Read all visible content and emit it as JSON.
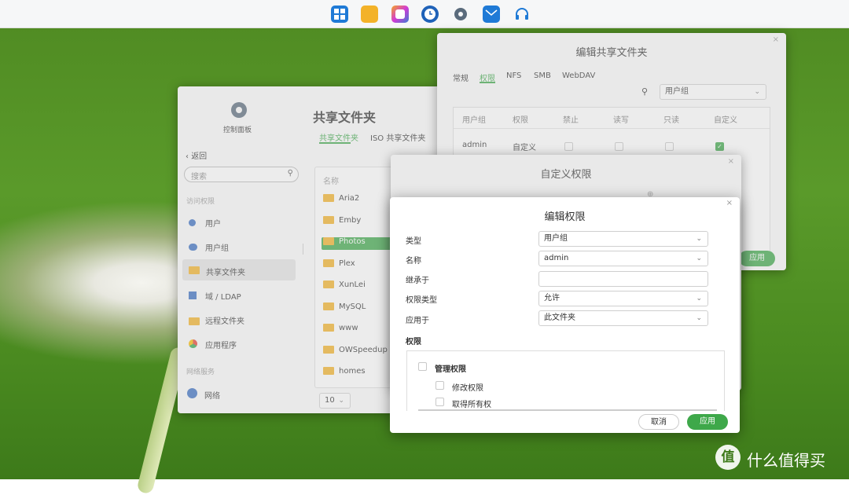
{
  "taskbar": {
    "icons": [
      {
        "name": "start-icon",
        "color": "#1f7ad6"
      },
      {
        "name": "folder-icon",
        "color": "#f3b229"
      },
      {
        "name": "app-center-icon",
        "color": "#c23bd4"
      },
      {
        "name": "clock-icon",
        "color": "#1f62b8"
      },
      {
        "name": "settings-icon",
        "color": "#5a6b7c"
      },
      {
        "name": "mail-icon",
        "color": "#1f7ad6"
      },
      {
        "name": "headset-icon",
        "color": "#1f7ad6"
      }
    ]
  },
  "control_panel": {
    "title": "控制面板",
    "back": "返回",
    "search_placeholder": "搜索",
    "section_access": "访问权限",
    "items": [
      "用户",
      "用户组",
      "共享文件夹",
      "域 / LDAP",
      "远程文件夹",
      "应用程序"
    ],
    "section_network": "网络服务",
    "network_item": "网络",
    "page_title": "共享文件夹",
    "tabs": [
      "共享文件夹",
      "ISO 共享文件夹"
    ],
    "list_header": "名称",
    "folders": [
      "Aria2",
      "Emby",
      "Photos",
      "Plex",
      "XunLei",
      "MySQL",
      "www",
      "OWSpeedup",
      "homes"
    ],
    "page_size": "10"
  },
  "edit_share": {
    "title": "编辑共享文件夹",
    "tabs": [
      "常规",
      "权限",
      "NFS",
      "SMB",
      "WebDAV"
    ],
    "filter": "用户组",
    "columns": [
      "用户组",
      "权限",
      "禁止",
      "读写",
      "只读",
      "自定义"
    ],
    "row": {
      "user": "admin",
      "perm": "自定义"
    },
    "apply": "应用"
  },
  "custom_perm": {
    "title": "自定义权限"
  },
  "edit_perm": {
    "title": "编辑权限",
    "fields": [
      {
        "label": "类型",
        "value": "用户组"
      },
      {
        "label": "名称",
        "value": "admin"
      },
      {
        "label": "继承于",
        "value": ""
      },
      {
        "label": "权限类型",
        "value": "允许"
      },
      {
        "label": "应用于",
        "value": "此文件夹"
      }
    ],
    "perm_section": "权限",
    "tree": {
      "group": "管理权限",
      "items": [
        "修改权限",
        "取得所有权"
      ]
    },
    "cancel": "取消",
    "apply": "应用"
  },
  "watermark": {
    "text": "什么值得买",
    "logo": "值"
  },
  "colors": {
    "accent": "#3ea84a",
    "folder": "#f3b229"
  }
}
